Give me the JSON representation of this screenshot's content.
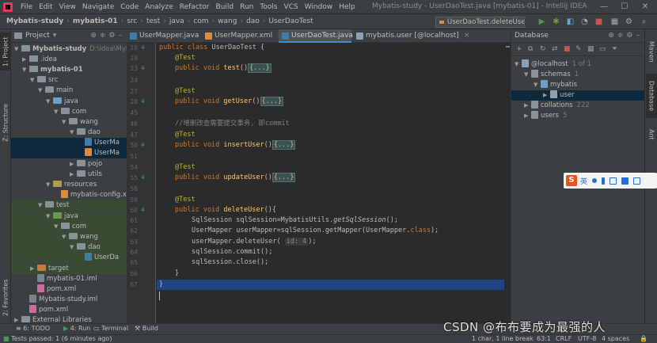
{
  "menu": [
    "File",
    "Edit",
    "View",
    "Navigate",
    "Code",
    "Analyze",
    "Refactor",
    "Build",
    "Run",
    "Tools",
    "VCS",
    "Window",
    "Help"
  ],
  "window_title": "Mybatis-study - UserDaoTest.java [mybatis-01] - IntelliJ IDEA",
  "breadcrumbs": [
    "Mybatis-study",
    "mybatis-01",
    "src",
    "test",
    "java",
    "com",
    "wang",
    "dao",
    "UserDaoTest"
  ],
  "run_config": "UserDaoTest.deleteUser",
  "left_tools": [
    "1: Project",
    "Z: Structure",
    "2: Favorites"
  ],
  "right_tools": [
    "Maven",
    "Database",
    "Ant"
  ],
  "project": {
    "title": "Project",
    "rows": [
      {
        "arrow": "▼",
        "icon": "fold",
        "text": "Mybatis-study",
        "extra": "D:\\idea\\MybatisSt",
        "bold": true
      },
      {
        "arrow": "▶",
        "icon": "fold",
        "text": ".idea",
        "extra": ""
      },
      {
        "arrow": "▼",
        "icon": "fold",
        "text": "mybatis-01",
        "extra": "",
        "bold": true
      },
      {
        "arrow": "▼",
        "icon": "fold",
        "text": "src",
        "extra": ""
      },
      {
        "arrow": "▼",
        "icon": "fold",
        "text": "main",
        "extra": ""
      },
      {
        "arrow": "▼",
        "icon": "blue",
        "text": "java",
        "extra": ""
      },
      {
        "arrow": "▼",
        "icon": "fold",
        "text": "com",
        "extra": ""
      },
      {
        "arrow": "▼",
        "icon": "fold",
        "text": "wang",
        "extra": ""
      },
      {
        "arrow": "▼",
        "icon": "fold",
        "text": "dao",
        "extra": ""
      },
      {
        "arrow": "",
        "icon": "java",
        "text": "UserMa",
        "extra": ""
      },
      {
        "arrow": "",
        "icon": "xml",
        "text": "UserMa",
        "extra": ""
      },
      {
        "arrow": "▶",
        "icon": "fold",
        "text": "pojo",
        "extra": ""
      },
      {
        "arrow": "▶",
        "icon": "fold",
        "text": "utils",
        "extra": ""
      },
      {
        "arrow": "▼",
        "icon": "yellow",
        "text": "resources",
        "extra": ""
      },
      {
        "arrow": "",
        "icon": "xml",
        "text": "mybatis-config.xr",
        "extra": ""
      },
      {
        "arrow": "▼",
        "icon": "fold",
        "text": "test",
        "extra": ""
      },
      {
        "arrow": "▼",
        "icon": "green",
        "text": "java",
        "extra": ""
      },
      {
        "arrow": "▼",
        "icon": "fold",
        "text": "com",
        "extra": ""
      },
      {
        "arrow": "▼",
        "icon": "fold",
        "text": "wang",
        "extra": ""
      },
      {
        "arrow": "▼",
        "icon": "fold",
        "text": "dao",
        "extra": ""
      },
      {
        "arrow": "",
        "icon": "java",
        "text": "UserDa",
        "extra": ""
      },
      {
        "arrow": "▶",
        "icon": "orange",
        "text": "target",
        "extra": ""
      },
      {
        "arrow": "",
        "icon": "iml",
        "text": "mybatis-01.iml",
        "extra": ""
      },
      {
        "arrow": "",
        "icon": "m",
        "text": "pom.xml",
        "extra": ""
      },
      {
        "arrow": "",
        "icon": "iml",
        "text": "Mybatis-study.iml",
        "extra": ""
      },
      {
        "arrow": "",
        "icon": "m",
        "text": "pom.xml",
        "extra": ""
      },
      {
        "arrow": "▶",
        "icon": "fold",
        "text": "External Libraries",
        "extra": ""
      }
    ]
  },
  "tabs": [
    "UserMapper.java",
    "UserMapper.xml",
    "UserDaoTest.java",
    "mybatis.user [@localhost]"
  ],
  "line_numbers": [
    "18",
    "19",
    "",
    "23",
    "24",
    "",
    "27",
    "28",
    "",
    "45",
    "46",
    "47",
    "",
    "50",
    "51",
    "",
    "54",
    "55",
    "",
    "58",
    "59",
    "60",
    "61",
    "62",
    "63",
    "64",
    "65",
    "66",
    "67"
  ],
  "gutter_lines": [
    "18",
    "19",
    "23",
    "24",
    "27",
    "28",
    "45",
    "46",
    "47",
    "50",
    "51",
    "54",
    "55",
    "58",
    "59",
    "60",
    "61",
    "62",
    "63",
    "64",
    "65",
    "66",
    "67"
  ],
  "code": {
    "l1_a": "public class ",
    "l1_b": "UserDaoTest {",
    "ann": "@Test",
    "pv": "public void ",
    "test": "test",
    "getUser": "getUser",
    "insertUser": "insertUser",
    "updateUser": "updateUser",
    "deleteUser": "deleteUser",
    "paren": "()",
    "folded": "{...}",
    "comment": "//增删改查需要提交事务, 即commit",
    "open_brace": "(){",
    "s1_a": "SqlSession sqlSession=MybatisUtils.",
    "s1_b": "getSqlSession",
    "s1_c": "();",
    "s2_a": "UserMapper userMapper=sqlSession.getMapper(UserMapper.",
    "s2_b": "class",
    "s2_c": ");",
    "s3_a": "userMapper.deleteUser( ",
    "s3_hint": "id: 4",
    "s3_c": ");",
    "s4": "sqlSession.commit();",
    "s5": "sqlSession.close();",
    "close_inner": "}",
    "close_outer": "}"
  },
  "db": {
    "title": "Database",
    "rows": [
      {
        "indent": 0,
        "arrow": "▼",
        "text": "@localhost",
        "extra": "1 of 1",
        "sel": false
      },
      {
        "indent": 1,
        "arrow": "▼",
        "text": "schemas",
        "extra": "1",
        "sel": false
      },
      {
        "indent": 2,
        "arrow": "▼",
        "text": "mybatis",
        "extra": "",
        "sel": false
      },
      {
        "indent": 3,
        "arrow": "▶",
        "text": "user",
        "extra": "",
        "sel": true
      },
      {
        "indent": 1,
        "arrow": "▶",
        "text": "collations",
        "extra": "222",
        "sel": false
      },
      {
        "indent": 1,
        "arrow": "▶",
        "text": "users",
        "extra": "5",
        "sel": false
      }
    ]
  },
  "bottom_tools": [
    "6: TODO",
    "4: Run",
    "Terminal",
    "Build"
  ],
  "status": {
    "left": "Tests passed: 1 (6 minutes ago)",
    "chars": "1 char, 1 line break",
    "pos": "63:1",
    "sep": "CRLF",
    "enc": "UTF-8",
    "indent": "4 spaces"
  },
  "ime": {
    "label": "英"
  },
  "watermark": "CSDN @布布要成为最强的人"
}
